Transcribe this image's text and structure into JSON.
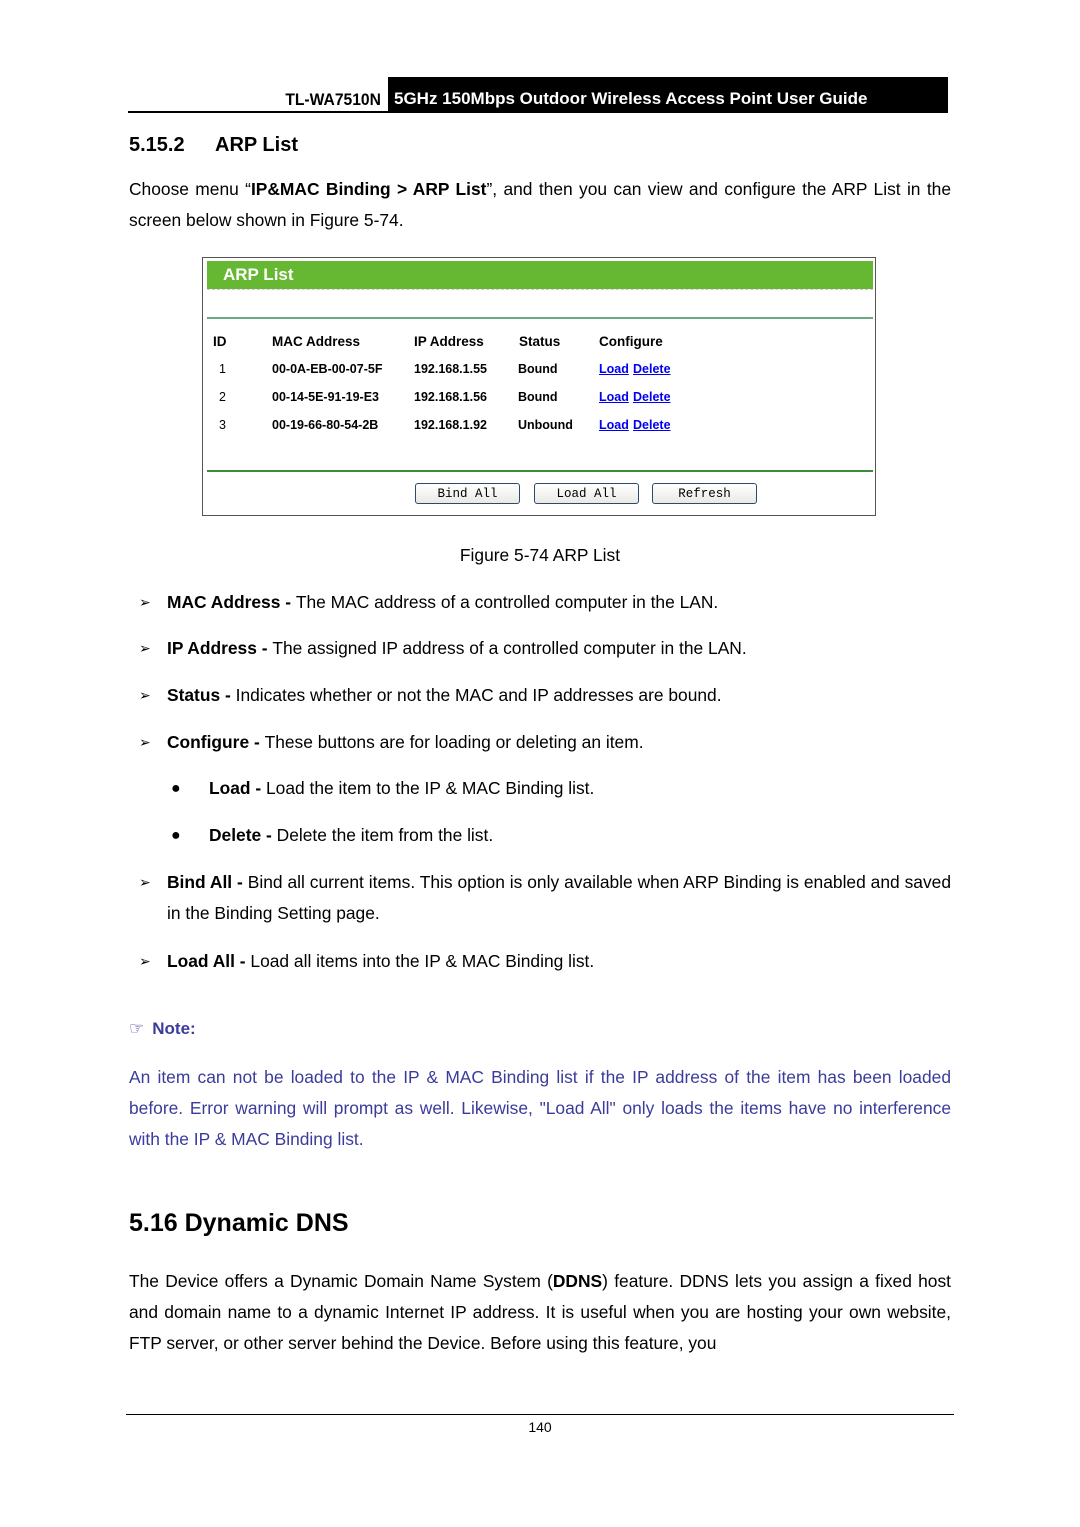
{
  "header": {
    "model": "TL-WA7510N",
    "guide_title": "5GHz 150Mbps Outdoor Wireless Access Point User Guide"
  },
  "section": {
    "number": "5.15.2",
    "title": "ARP List",
    "intro_prefix": "Choose menu “",
    "intro_menu": "IP&MAC Binding > ARP List",
    "intro_suffix": "”, and then you can view and configure the ARP List in the screen below shown in Figure 5-74."
  },
  "figure": {
    "panel_title": "ARP List",
    "columns": [
      "ID",
      "MAC Address",
      "IP Address",
      "Status",
      "Configure"
    ],
    "rows": [
      {
        "id": "1",
        "mac": "00-0A-EB-00-07-5F",
        "ip": "192.168.1.55",
        "status": "Bound",
        "load": "Load",
        "delete": "Delete"
      },
      {
        "id": "2",
        "mac": "00-14-5E-91-19-E3",
        "ip": "192.168.1.56",
        "status": "Bound",
        "load": "Load",
        "delete": "Delete"
      },
      {
        "id": "3",
        "mac": "00-19-66-80-54-2B",
        "ip": "192.168.1.92",
        "status": "Unbound",
        "load": "Load",
        "delete": "Delete"
      }
    ],
    "buttons": {
      "bind_all": "Bind All",
      "load_all": "Load All",
      "refresh": "Refresh"
    },
    "caption": "Figure 5-74 ARP List",
    "link_color": "#0000ee",
    "title_bar_color": "#66b832"
  },
  "descriptions": [
    {
      "term": "MAC Address - ",
      "text": "The MAC address of a controlled computer in the LAN."
    },
    {
      "term": "IP Address - ",
      "text": "The assigned IP address of a controlled computer in the LAN."
    },
    {
      "term": "Status - ",
      "text": "Indicates whether or not the MAC and IP addresses are bound."
    },
    {
      "term": "Configure - ",
      "text": "These buttons are for loading or deleting an item."
    }
  ],
  "sub_descriptions": [
    {
      "term": "Load - ",
      "text": "Load the item to the IP & MAC Binding list."
    },
    {
      "term": "Delete - ",
      "text": "Delete the item from the list."
    }
  ],
  "more_descriptions": [
    {
      "term": "Bind All - ",
      "text": "Bind all current items. This option is only available when ARP Binding is enabled and saved in the Binding Setting page."
    },
    {
      "term": "Load All - ",
      "text": "Load all items into the IP & MAC Binding list."
    }
  ],
  "note": {
    "label": "Note:",
    "icon": "pointing-hand-icon",
    "text": "An item can not be loaded to the IP & MAC Binding list if the IP address of the item has been loaded before. Error warning will prompt as well. Likewise, \"Load All\" only loads the items have no interference with the IP & MAC Binding list.",
    "color": "#3b3b9b"
  },
  "ddns": {
    "heading": "5.16 Dynamic DNS",
    "text_prefix": "The Device offers a Dynamic Domain Name System (",
    "text_bold": "DDNS",
    "text_suffix": ") feature. DDNS lets you assign a fixed host and domain name to a dynamic Internet IP address. It is useful when you are hosting your own website, FTP server, or other server behind the Device. Before using this feature, you"
  },
  "footer": {
    "page_number": "140"
  }
}
